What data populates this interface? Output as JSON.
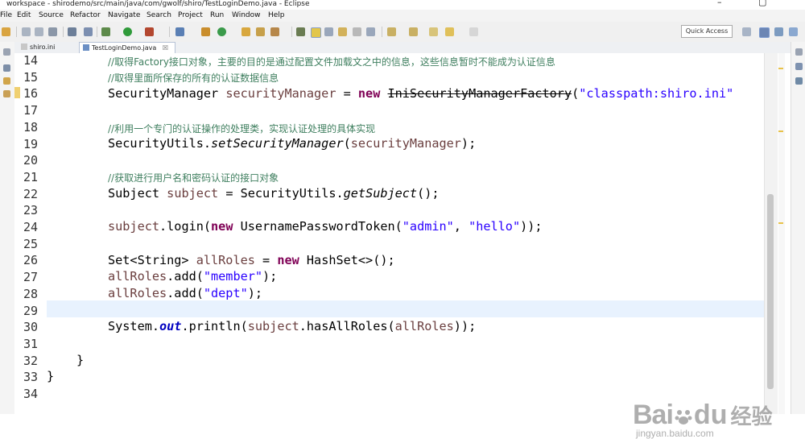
{
  "window": {
    "title": "workspace - shirodemo/src/main/java/com/gwolf/shiro/TestLoginDemo.java - Eclipse",
    "minimize": "–",
    "maximize": "▢"
  },
  "menu": [
    "File",
    "Edit",
    "Source",
    "Refactor",
    "Navigate",
    "Search",
    "Project",
    "Run",
    "Window",
    "Help"
  ],
  "quick_access": "Quick Access",
  "tabs": [
    {
      "label": "shiro.ini",
      "active": false
    },
    {
      "label": "TestLoginDemo.java",
      "active": true,
      "close": "☒"
    }
  ],
  "line_numbers": [
    "14",
    "15",
    "16",
    "17",
    "18",
    "19",
    "20",
    "21",
    "22",
    "23",
    "24",
    "25",
    "26",
    "27",
    "28",
    "29",
    "30",
    "31",
    "32",
    "33",
    "34"
  ],
  "code": {
    "l14": "//取得Factory接口对象，主要的目的是通过配置文件加载文之中的信息，这些信息暂时不能成为认证信息",
    "l15": "//取得里面所保存的所有的认证数据信息",
    "l16": {
      "type": "SecurityManager",
      "var": "securityManager",
      "eq": " = ",
      "kw_new": "new",
      "cls": "IniSecurityManagerFactory",
      "open": "(",
      "str": "\"classpath:shiro.ini\""
    },
    "l18": "//利用一个专门的认证操作的处理类，实现认证处理的具体实现",
    "l19": {
      "cls": "SecurityUtils.",
      "method": "setSecurityManager",
      "open": "(",
      "var": "securityManager",
      "close": ");"
    },
    "l21": "//获取进行用户名和密码认证的接口对象",
    "l22": {
      "type": "Subject",
      "var": "subject",
      "eq": " = SecurityUtils.",
      "method": "getSubject",
      "close": "();"
    },
    "l24": {
      "var": "subject",
      "call": ".login(",
      "kw_new": "new",
      "cls": " UsernamePasswordToken(",
      "s1": "\"admin\"",
      "sep": ", ",
      "s2": "\"hello\"",
      "close": "));"
    },
    "l26": {
      "type": "Set<String> ",
      "var": "allRoles",
      "eq": " = ",
      "kw_new": "new",
      "rest": " HashSet<>();"
    },
    "l27": {
      "var": "allRoles",
      "call": ".add(",
      "str": "\"member\"",
      "close": ");"
    },
    "l28": {
      "var": "allRoles",
      "call": ".add(",
      "str": "\"dept\"",
      "close": ");"
    },
    "l30": {
      "cls": "System.",
      "field": "out",
      "call": ".println(",
      "var1": "subject",
      "call2": ".hasAllRoles(",
      "var2": "allRoles",
      "close": "));"
    },
    "l32": "}",
    "l33": "}"
  },
  "watermark": {
    "brand": "Bai",
    "brand2": "du",
    "cn": "经验",
    "url": "jingyan.baidu.com"
  },
  "colors": {
    "keyword": "#7f0055",
    "string": "#2a00ff",
    "comment": "#3f7f5f",
    "local_var": "#6a3e3e",
    "field": "#0000c0",
    "current_line": "#e8f2fe"
  }
}
